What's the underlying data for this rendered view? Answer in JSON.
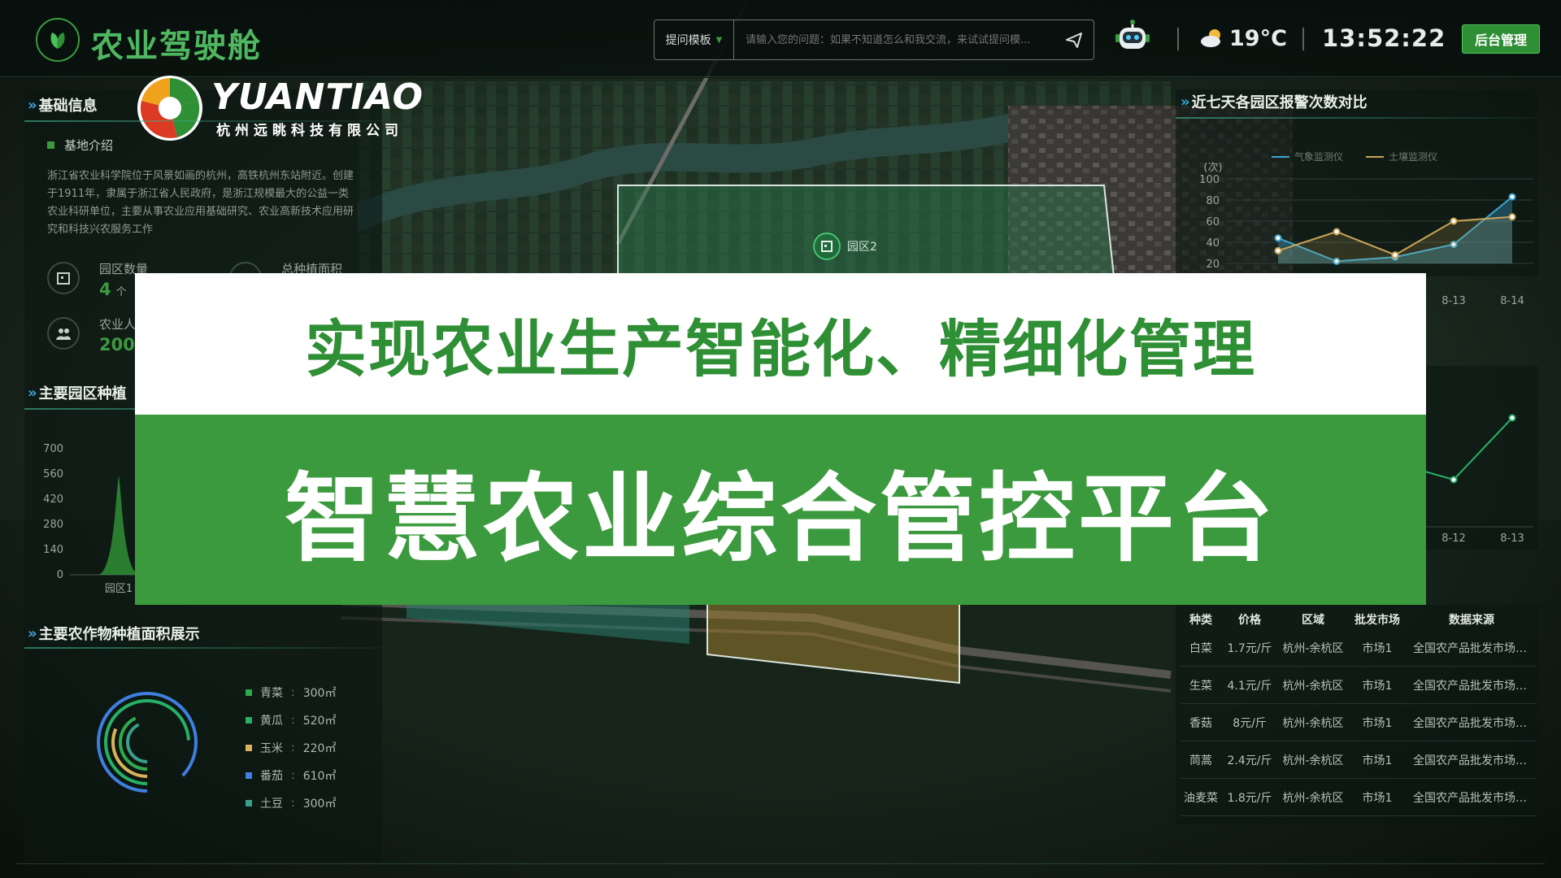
{
  "header": {
    "app_title": "农业驾驶舱",
    "template_label": "提问模板",
    "search_placeholder": "请输入您的问题：如果不知道怎么和我交流，来试试提问模...",
    "weather_temp": "19°C",
    "clock": "13:52:22",
    "admin_button": "后台管理"
  },
  "logo": {
    "brand": "YUANTIAO",
    "company": "杭州远眺科技有限公司"
  },
  "basic_info": {
    "title": "基础信息",
    "subtitle": "基地介绍",
    "intro": "浙江省农业科学院位于风景如画的杭州，高铁杭州东站附近。创建于1911年，隶属于浙江省人民政府，是浙江规模最大的公益一类农业科研单位，主要从事农业应用基础研究、农业高新技术应用研究和科技兴农服务工作",
    "stats": [
      {
        "label": "园区数量",
        "value": "4",
        "unit": "个"
      },
      {
        "label": "总种植面积",
        "value": "",
        "unit": ""
      },
      {
        "label": "农业人",
        "value": "200",
        "unit": ""
      }
    ]
  },
  "park_planting": {
    "title": "主要园区种植",
    "y_ticks": [
      "700",
      "560",
      "420",
      "280",
      "140",
      "0"
    ],
    "x_label": "园区1"
  },
  "crop_area": {
    "title": "主要农作物种植面积展示",
    "items": [
      {
        "label": "青菜",
        "value": "300㎡",
        "color": "#2faa4f"
      },
      {
        "label": "黄瓜",
        "value": "520㎡",
        "color": "#27b065"
      },
      {
        "label": "玉米",
        "value": "220㎡",
        "color": "#d9b25b"
      },
      {
        "label": "番茄",
        "value": "610㎡",
        "color": "#3f7fe0"
      },
      {
        "label": "土豆",
        "value": "300㎡",
        "color": "#3a9f8a"
      }
    ]
  },
  "alarm_chart": {
    "title": "近七天各园区报警次数对比",
    "unit": "(次)",
    "legend": [
      "气象监测仪",
      "土壤监测仪"
    ],
    "y_ticks": [
      "100",
      "80",
      "60",
      "40",
      "20"
    ],
    "x_visible": [
      "8-13",
      "8-14"
    ]
  },
  "second_chart": {
    "x_visible": [
      "8-12",
      "8-13"
    ]
  },
  "market_table": {
    "headers": [
      "种类",
      "价格",
      "区域",
      "批发市场",
      "数据来源"
    ],
    "rows": [
      [
        "白菜",
        "1.7元/斤",
        "杭州-余杭区",
        "市场1",
        "全国农产品批发市场价..."
      ],
      [
        "生菜",
        "4.1元/斤",
        "杭州-余杭区",
        "市场1",
        "全国农产品批发市场价..."
      ],
      [
        "香菇",
        "8元/斤",
        "杭州-余杭区",
        "市场1",
        "全国农产品批发市场价..."
      ],
      [
        "茼蒿",
        "2.4元/斤",
        "杭州-余杭区",
        "市场1",
        "全国农产品批发市场价..."
      ],
      [
        "油麦菜",
        "1.8元/斤",
        "杭州-余杭区",
        "市场1",
        "全国农产品批发市场价..."
      ]
    ]
  },
  "map": {
    "zone_label": "园区2"
  },
  "banner": {
    "line1": "实现农业生产智能化、精细化管理",
    "line2": "智慧农业综合管控平台"
  },
  "colors": {
    "brand_green": "#3c9a3e",
    "accent_blue": "#3aa7e0",
    "banner_text_green": "#2f8f35"
  }
}
